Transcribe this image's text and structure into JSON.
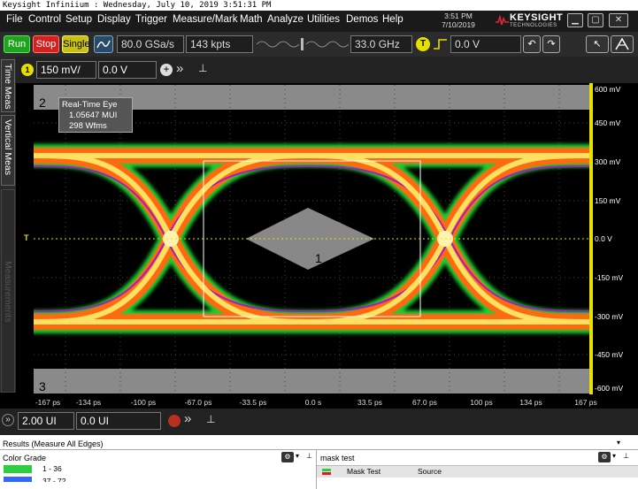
{
  "window_title": "Keysight Infiniium : Wednesday, July 10, 2019 3:51:31 PM",
  "menu": [
    "File",
    "Control",
    "Setup",
    "Display",
    "Trigger",
    "Measure/Mark",
    "Math",
    "Analyze",
    "Utilities",
    "Demos",
    "Help"
  ],
  "clock": {
    "time": "3:51 PM",
    "date": "7/10/2019"
  },
  "logo": {
    "brand": "KEYSIGHT",
    "sub": "TECHNOLOGIES"
  },
  "toolbar": {
    "run_label": "Run",
    "stop_label": "Stop",
    "single_label": "Single",
    "sample_rate": "80.0 GSa/s",
    "memory_depth": "143 kpts",
    "bandwidth": "33.0 GHz",
    "trigger_badge": "T",
    "trigger_level": "0.0 V"
  },
  "channel": {
    "number": "1",
    "scale": "150 mV/",
    "offset": "0.0 V"
  },
  "side_tabs": {
    "time_meas": "Time Meas",
    "vertical_meas": "Vertical Meas",
    "measurements": "Measurements"
  },
  "plot": {
    "region_top_label": "2",
    "region_bottom_label": "3",
    "mask_label": "1",
    "trigger_marker": "T",
    "info": {
      "title": "Real-Time Eye",
      "mui": "1.05647 MUI",
      "wfms": "298 Wfms"
    }
  },
  "y_ticks": [
    "600 mV",
    "450 mV",
    "300 mV",
    "150 mV",
    "0.0 V",
    "-150 mV",
    "-300 mV",
    "-450 mV",
    "-600 mV"
  ],
  "x_ticks": [
    "-167 ps",
    "-134 ps",
    "-100 ps",
    "-67.0 ps",
    "-33.5 ps",
    "0.0 s",
    "33.5 ps",
    "67.0 ps",
    "100 ps",
    "134 ps",
    "167 ps"
  ],
  "timebase": {
    "scale": "2.00 UI",
    "position": "0.0 UI"
  },
  "results": {
    "header": "Results   (Measure All Edges)",
    "left_panel_title": "Color Grade",
    "color_grade_rows": [
      {
        "range": "1 - 36",
        "color": "#2ecc40"
      },
      {
        "range": "37 - 72",
        "color": "#3366ff"
      }
    ],
    "right_panel_title": "mask test",
    "mask_test_label": "Mask Test",
    "source_label": "Source"
  },
  "colors": {
    "run": "#1fa31f",
    "stop": "#d81e1e",
    "single": "#c9c016",
    "trace_yellow": "#e6e000",
    "mask_gray": "#888888"
  }
}
